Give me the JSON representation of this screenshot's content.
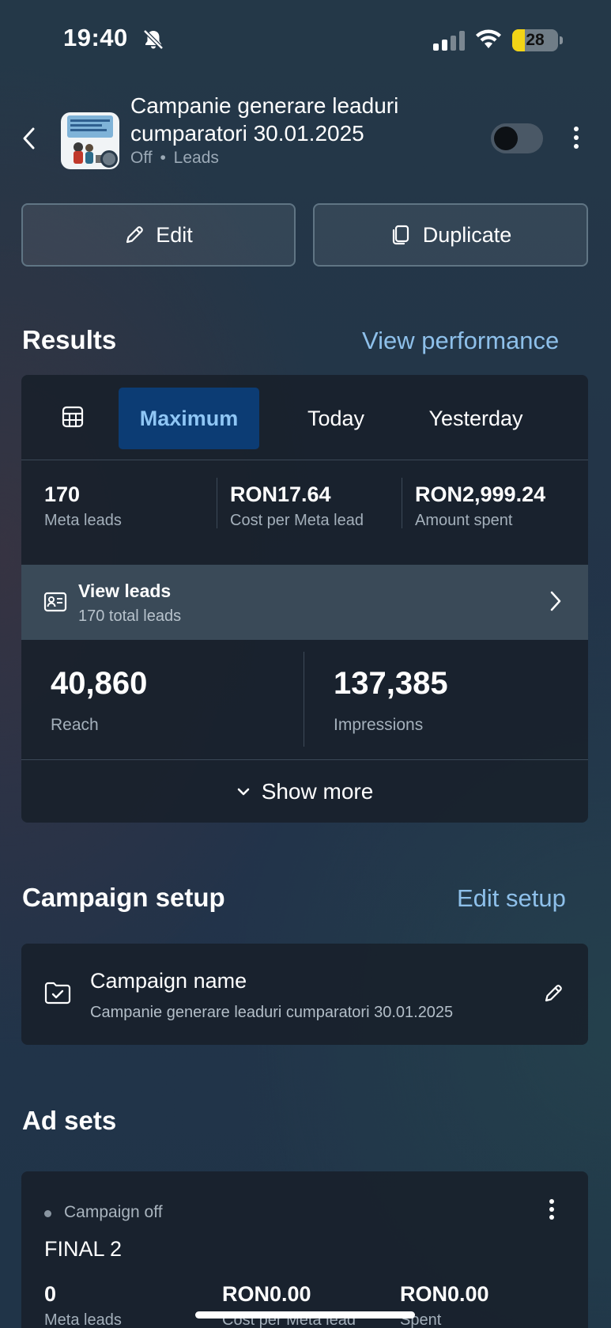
{
  "status_bar": {
    "time": "19:40",
    "battery": "28"
  },
  "header": {
    "title": "Campanie generare leaduri cumparatori 30.01.2025",
    "status": "Off",
    "objective": "Leads",
    "separator": "•"
  },
  "actions": {
    "edit_label": "Edit",
    "duplicate_label": "Duplicate"
  },
  "results": {
    "title": "Results",
    "link": "View performance",
    "tabs": [
      {
        "label": "Maximum",
        "active": true
      },
      {
        "label": "Today",
        "active": false
      },
      {
        "label": "Yesterday",
        "active": false
      }
    ],
    "metrics": [
      {
        "value": "170",
        "label": "Meta leads"
      },
      {
        "value": "RON17.64",
        "label": "Cost per Meta lead"
      },
      {
        "value": "RON2,999.24",
        "label": "Amount spent"
      }
    ],
    "view_leads": {
      "title": "View leads",
      "subtitle": "170 total leads"
    },
    "reach": {
      "value": "40,860",
      "label": "Reach"
    },
    "impressions": {
      "value": "137,385",
      "label": "Impressions"
    },
    "show_more": "Show more"
  },
  "setup": {
    "title": "Campaign setup",
    "link": "Edit setup",
    "name_label": "Campaign name",
    "name_value": "Campanie generare leaduri cumparatori 30.01.2025"
  },
  "ad_sets": {
    "title": "Ad sets",
    "items": [
      {
        "status": "Campaign off",
        "name": "FINAL 2",
        "metrics": [
          {
            "value": "0",
            "label": "Meta leads"
          },
          {
            "value": "RON0.00",
            "label": "Cost per Meta lead"
          },
          {
            "value": "RON0.00",
            "label": "Spent"
          }
        ]
      }
    ]
  },
  "colors": {
    "accent": "#8ec0ea",
    "active_tab_bg": "#0c3c74",
    "battery": "#f2d416"
  }
}
